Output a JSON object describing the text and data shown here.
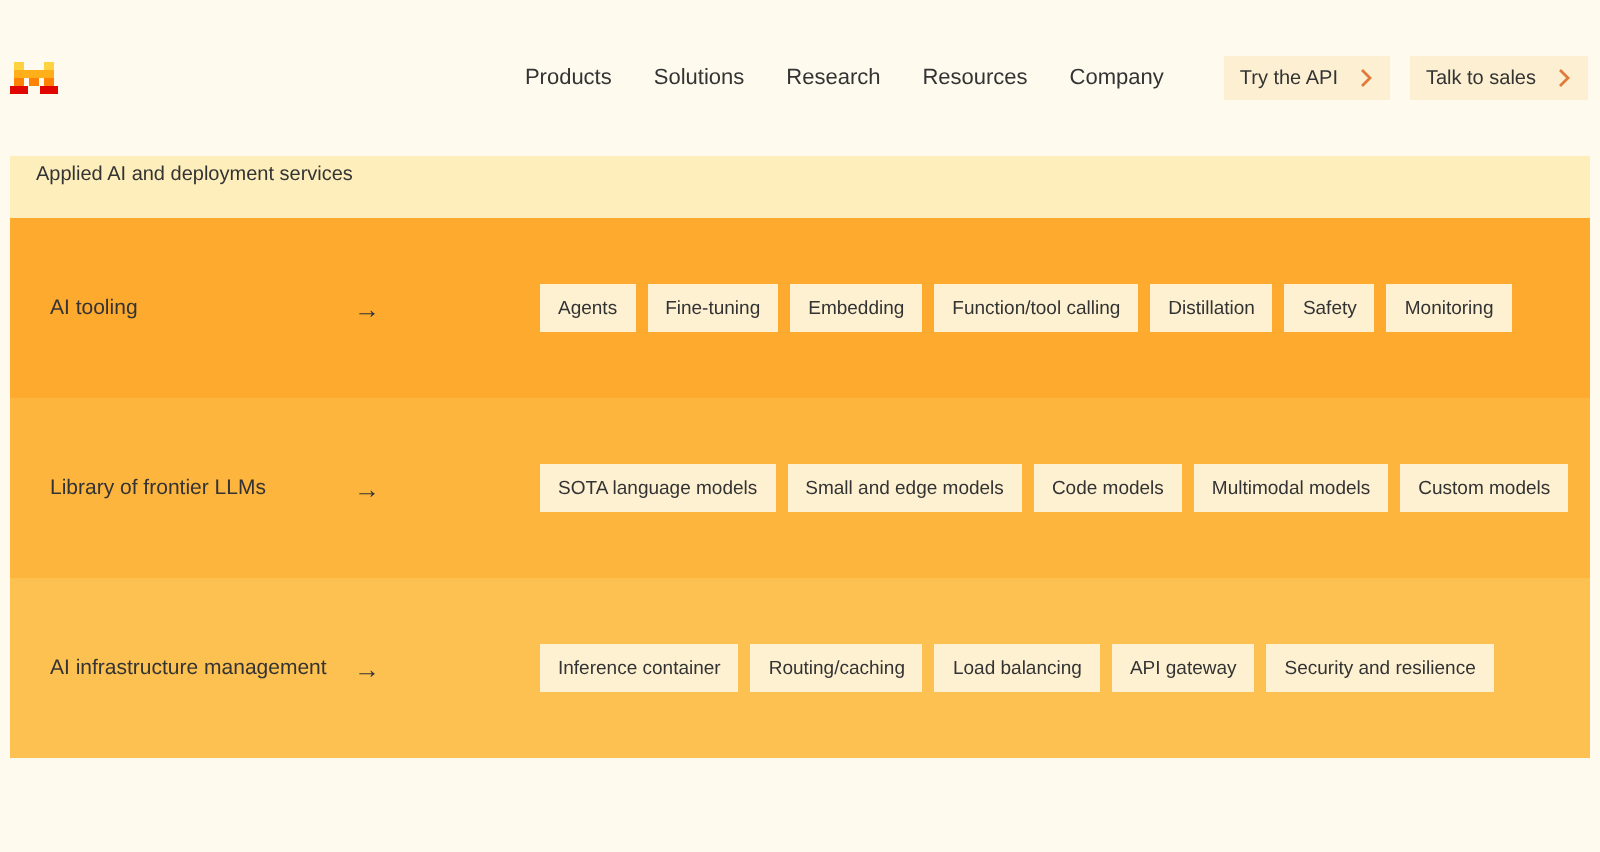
{
  "nav": {
    "links": [
      "Products",
      "Solutions",
      "Research",
      "Resources",
      "Company"
    ],
    "buttons": [
      "Try the API",
      "Talk to sales"
    ]
  },
  "panel": {
    "title": "Applied AI and deployment services",
    "rows": [
      {
        "label": "AI tooling",
        "arrow": "→",
        "color": "#fdaa2e",
        "chips": [
          "Agents",
          "Fine-tuning",
          "Embedding",
          "Function/tool calling",
          "Distillation",
          "Safety",
          "Monitoring"
        ]
      },
      {
        "label": "Library of frontier LLMs",
        "arrow": "→",
        "color": "#fdb53d",
        "chips": [
          "SOTA language models",
          "Small and edge models",
          "Code models",
          "Multimodal models",
          "Custom models"
        ]
      },
      {
        "label": "AI infrastructure management",
        "arrow": "→",
        "color": "#fdc152",
        "chips": [
          "Inference container",
          "Routing/caching",
          "Load balancing",
          "API gateway",
          "Security and resilience"
        ]
      }
    ]
  }
}
